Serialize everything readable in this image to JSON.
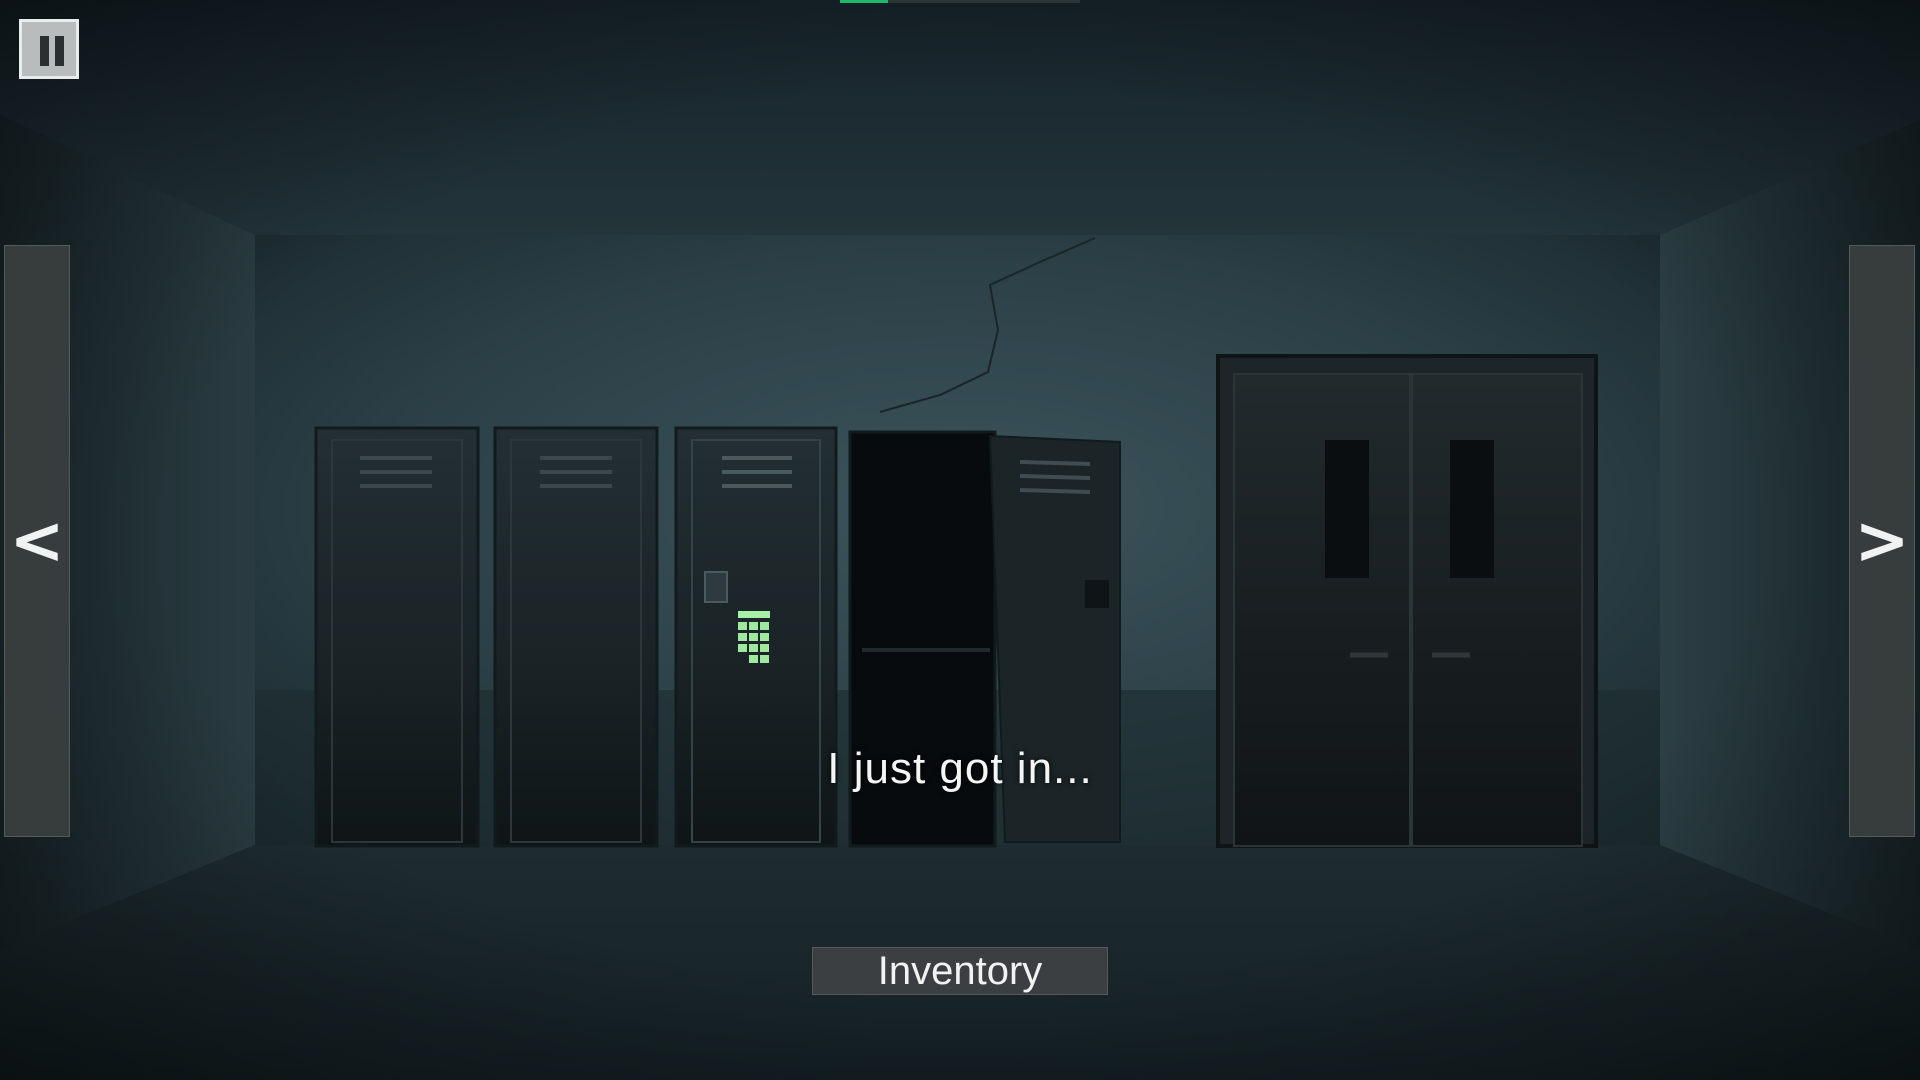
{
  "hud": {
    "pause_icon": "pause-icon",
    "progress_color": "#1fb86a",
    "progress_fraction": 0.2
  },
  "navigation": {
    "left_arrow": "<",
    "right_arrow": ">"
  },
  "subtitle": "I just got in...",
  "inventory_label": "Inventory",
  "colors": {
    "keypad_glow": "#a7f0a7",
    "wall": "#2b3c42",
    "floor": "#1a272b"
  }
}
